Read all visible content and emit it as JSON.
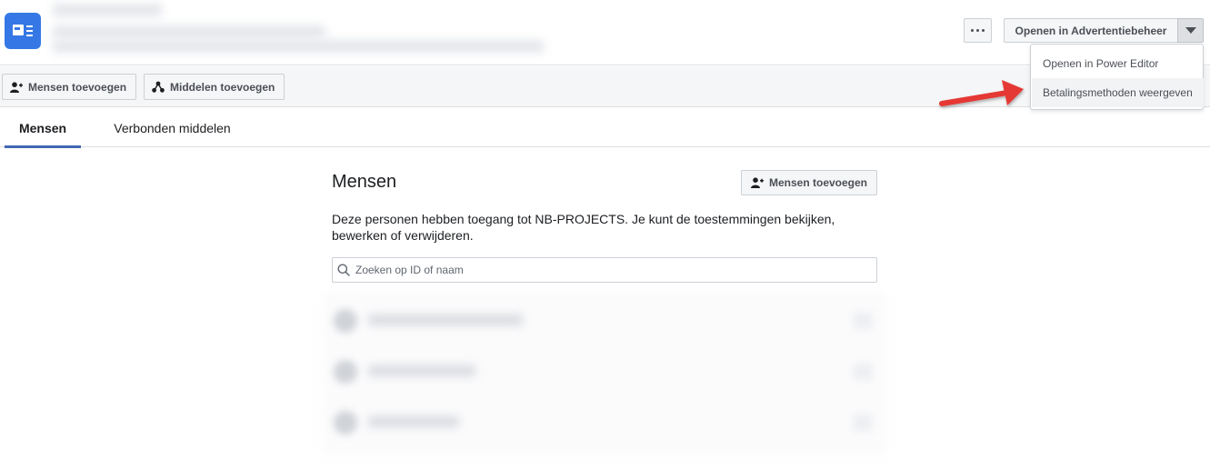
{
  "header": {
    "open_button_label": "Openen in Advertentiebeheer"
  },
  "toolbar": {
    "add_people_label": "Mensen toevoegen",
    "add_assets_label": "Middelen toevoegen"
  },
  "dropdown": {
    "items": [
      {
        "label": "Openen in Power Editor"
      },
      {
        "label": "Betalingsmethoden weergeven"
      }
    ]
  },
  "tabs": [
    {
      "label": "Mensen",
      "active": true
    },
    {
      "label": "Verbonden middelen",
      "active": false
    }
  ],
  "main": {
    "title": "Mensen",
    "add_people_label": "Mensen toevoegen",
    "description": "Deze personen hebben toegang tot NB-PROJECTS. Je kunt de toestemmingen bekijken, bewerken of verwijderen.",
    "search_placeholder": "Zoeken op ID of naam",
    "search_value": ""
  },
  "colors": {
    "accent": "#4267b2",
    "app_icon": "#3578e5",
    "annotation_arrow": "#e53935"
  },
  "icons": {
    "app": "ad-account-icon",
    "more": "more-dots-icon",
    "caret": "caret-down-icon",
    "add_person": "add-person-icon",
    "assets": "assets-icon",
    "search": "search-icon"
  }
}
